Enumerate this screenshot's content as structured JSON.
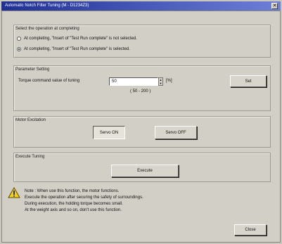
{
  "window": {
    "title": "Automatic Notch Filter Tuning (M - D1234Z3)"
  },
  "operation": {
    "label": "Select the operation at completing",
    "options": [
      {
        "label": "At completing, \"Insert of \"Test Run complete\" is not selected.",
        "checked": false
      },
      {
        "label": "At completing, \"Insert of \"Test Run complete\" is selected.",
        "checked": true
      }
    ]
  },
  "parameter": {
    "label": "Parameter Setting",
    "torque_label": "Torque command value of tuning",
    "torque_value": "50",
    "unit": "[%]",
    "range": "( 50 - 200 )",
    "set_button": "Set"
  },
  "motor": {
    "label": "Motor Excitation",
    "servo_on": "Servo ON",
    "servo_off": "Servo OFF"
  },
  "tuning": {
    "label": "Execute Tuning",
    "execute": "Execute"
  },
  "note": {
    "lines": [
      "Note : When use this function, the motor functions.",
      "Execute the operation after securing the safety of surroundings.",
      "During execution, the holding torque becomes small.",
      "At the weight axis and so on, don't use this function."
    ]
  },
  "close_button": "Close"
}
